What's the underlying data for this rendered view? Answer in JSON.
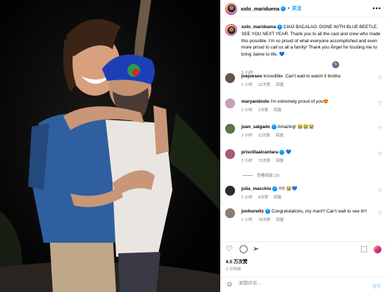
{
  "post": {
    "username": "xolo_mariduena",
    "follow_label": "关注",
    "more_label": "•••",
    "caption_username": "xolo_mariduena",
    "caption_text": " CIAO BACALAO. DONE WITH BLUE BEETLE. SEE YOU NEXT YEAR. Thank you to all the cast and crew who made this possible. I'm so proud of what everyone accomplished and even more proud to call us all a family! Thank you Ángel for trusting me to bring Jaime to life. 💙",
    "caption_time": "1 小时"
  },
  "comments": [
    {
      "user": "joejoeseo",
      "text": "Incredible. Can't wait to watch it brotha",
      "time": "1 小时",
      "likes": "22次赞",
      "reply": "回复",
      "avatar_color": "#6b5446"
    },
    {
      "user": "maryandxolo",
      "text": "i'm extremely proud of you😍",
      "time": "1 小时",
      "likes": "2次赞",
      "reply": "回复",
      "avatar_color": "#c7a0b8"
    },
    {
      "user": "juan_salgado",
      "text": "Amazing! 😭😭😭",
      "time": "1 小时",
      "likes": "11次赞",
      "reply": "回复",
      "avatar_color": "#5a7347",
      "verified": true
    },
    {
      "user": "priscillaalcantara",
      "text": "💙",
      "time": "1 小时",
      "likes": "73次赞",
      "reply": "回复",
      "avatar_color": "#a45a7a",
      "verified": true,
      "replies": "查看回复 (3)"
    },
    {
      "user": "julia_macchio",
      "text": "!!!!! 😭💙",
      "time": "1 小时",
      "likes": "8次赞",
      "reply": "回复",
      "avatar_color": "#2d2a28",
      "verified": true
    },
    {
      "user": "jonhurwitz",
      "text": "Congratulations, my man!!! Can't wait to see it!!!",
      "time": "1 小时",
      "likes": "78次赞",
      "reply": "回复",
      "avatar_color": "#8a7c72",
      "verified": true
    }
  ],
  "stats": {
    "likes": "6.5 万次赞",
    "time": "1 小时前"
  },
  "add_comment": {
    "placeholder": "添加评论...",
    "post_label": "发布"
  },
  "icons": [
    "heart-icon",
    "comment-icon",
    "share-icon",
    "save-icon",
    "emoji-icon",
    "translate-icon",
    "more-icon"
  ]
}
